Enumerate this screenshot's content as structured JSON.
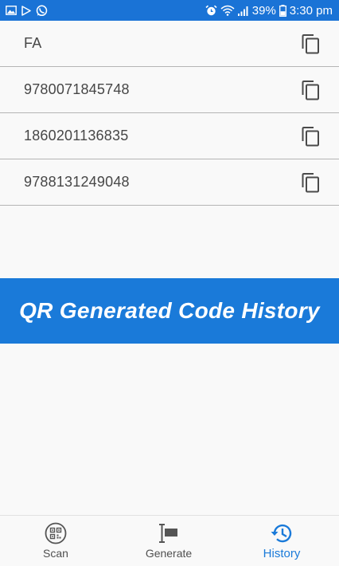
{
  "status_bar": {
    "battery": "39%",
    "time": "3:30 pm"
  },
  "history": {
    "items": [
      {
        "text": "FA"
      },
      {
        "text": "9780071845748"
      },
      {
        "text": "1860201136835"
      },
      {
        "text": "9788131249048"
      }
    ]
  },
  "banner": {
    "text": "QR Generated Code History"
  },
  "nav": {
    "items": [
      {
        "label": "Scan",
        "icon": "qr-scan-icon"
      },
      {
        "label": "Generate",
        "icon": "generate-icon"
      },
      {
        "label": "History",
        "icon": "history-icon",
        "active": true
      }
    ]
  },
  "colors": {
    "primary": "#1a7ad9",
    "status_bar": "#1a73d6",
    "text": "#474747",
    "divider": "#b5b5b5"
  }
}
